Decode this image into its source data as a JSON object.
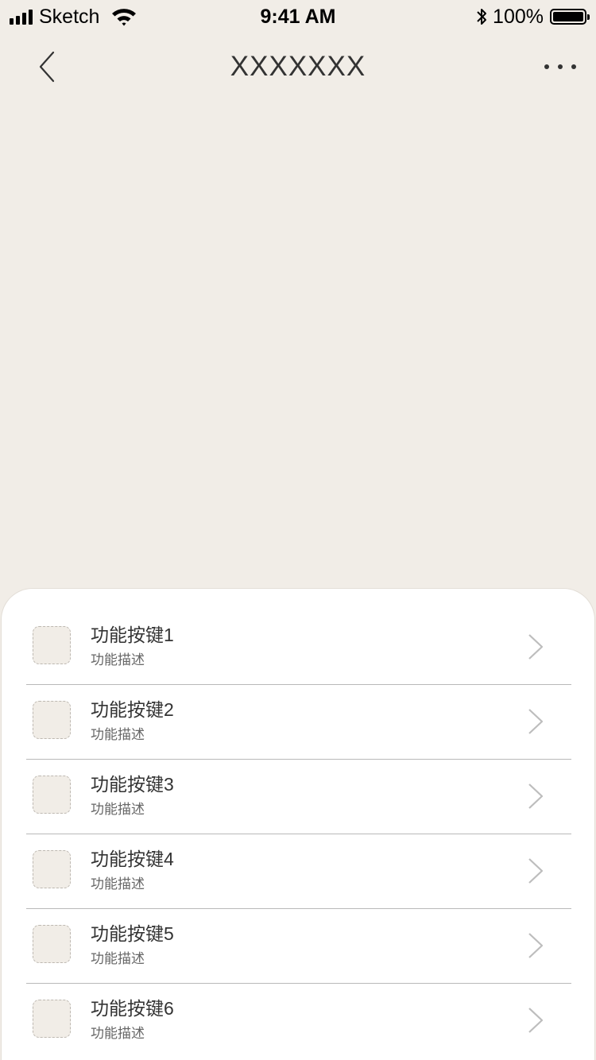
{
  "status_bar": {
    "carrier": "Sketch",
    "time": "9:41 AM",
    "battery": "100%",
    "battery_level": 1.0,
    "icons": [
      "signal-icon",
      "wifi-icon",
      "bluetooth-icon",
      "battery-icon"
    ]
  },
  "nav": {
    "title": "XXXXXXX",
    "icons": [
      "back-chevron-icon",
      "more-dots-icon"
    ]
  },
  "colors": {
    "background": "#f1ede7",
    "sheet": "#ffffff",
    "divider": "#b9b9b9",
    "chevron": "#bdbdbd"
  },
  "menu": {
    "items": [
      {
        "title": "功能按键1",
        "desc": "功能描述"
      },
      {
        "title": "功能按键2",
        "desc": "功能描述"
      },
      {
        "title": "功能按键3",
        "desc": "功能描述"
      },
      {
        "title": "功能按键4",
        "desc": "功能描述"
      },
      {
        "title": "功能按键5",
        "desc": "功能描述"
      },
      {
        "title": "功能按键6",
        "desc": "功能描述"
      }
    ]
  }
}
